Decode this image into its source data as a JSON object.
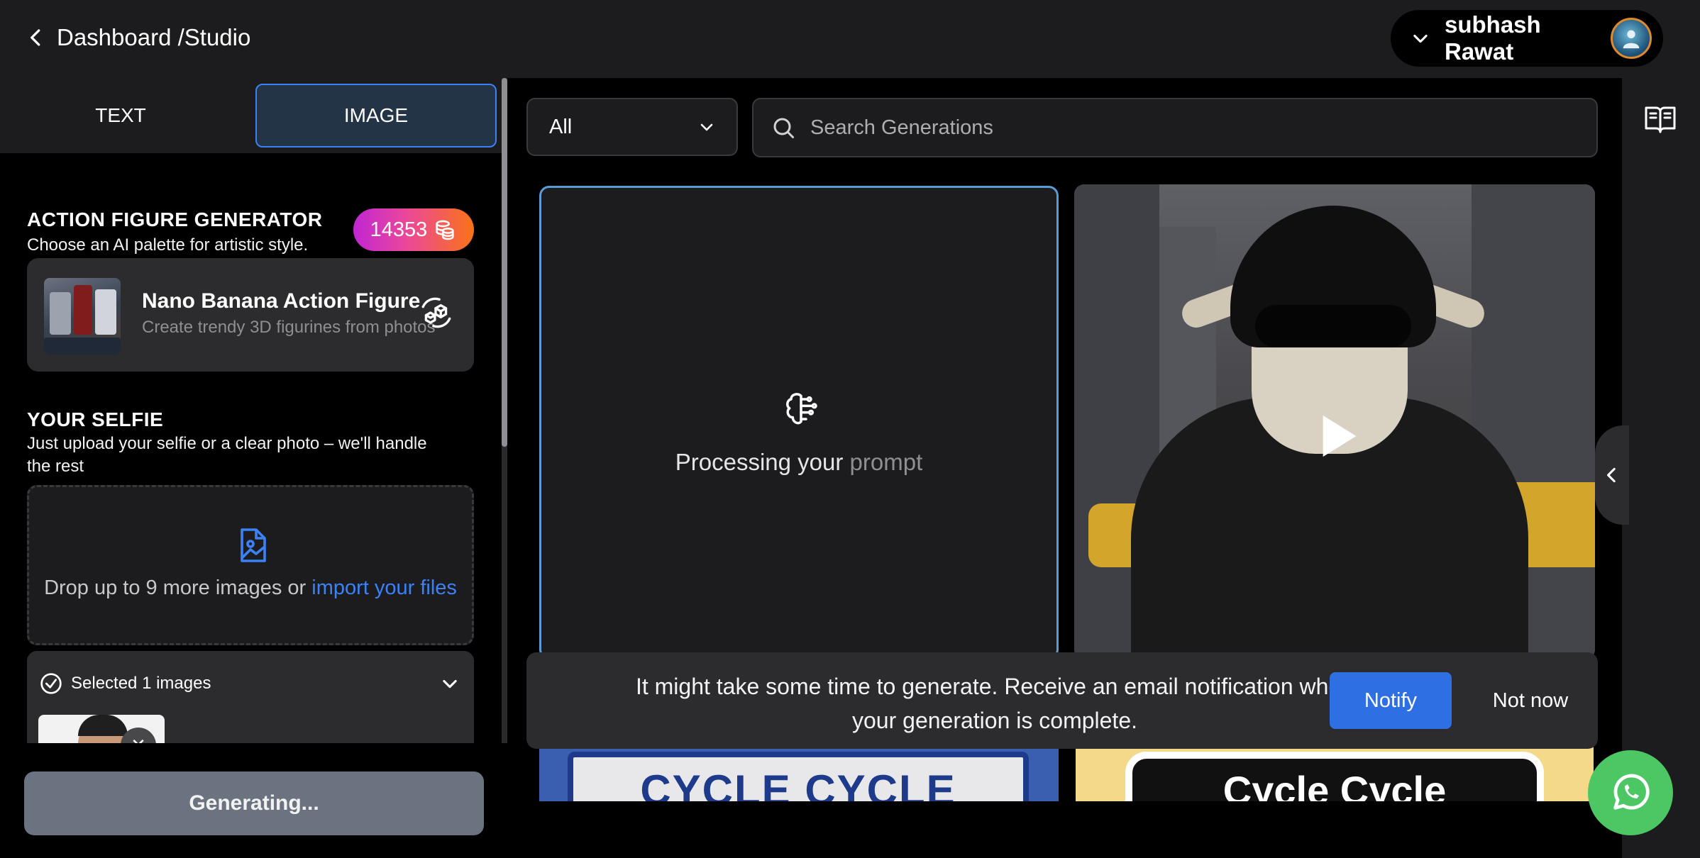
{
  "header": {
    "breadcrumb": "Dashboard /Studio",
    "user_name": "subhash Rawat"
  },
  "tabs": [
    {
      "label": "TEXT",
      "active": false
    },
    {
      "label": "IMAGE",
      "active": true
    }
  ],
  "generator": {
    "title": "ACTION FIGURE GENERATOR",
    "subtitle": "Choose an AI palette for artistic style.",
    "credits": "14353"
  },
  "model": {
    "name": "Nano Banana Action Figure",
    "description": "Create trendy 3D figurines from photos"
  },
  "selfie": {
    "title": "YOUR SELFIE",
    "subtitle_line1": "Just upload your selfie or a clear photo – we'll handle",
    "subtitle_line2": "the rest",
    "drop_text": "Drop up to 9 more images or ",
    "drop_link": "import your files",
    "selected_label": "Selected 1 images",
    "remove_glyph": "✕"
  },
  "generate_button": "Generating...",
  "filter": {
    "selected": "All"
  },
  "search": {
    "placeholder": "Search Generations"
  },
  "processing_card": {
    "text_main": "Processing your ",
    "text_fade": "prompt"
  },
  "thumbnails": {
    "left_text": "CYCLE CYCLE",
    "right_text": "Cycle Cycle"
  },
  "toast": {
    "message_line1": "It might take some time to generate. Receive an email notification when",
    "message_line2": "your generation is complete.",
    "notify_label": "Notify",
    "dismiss_label": "Not now"
  },
  "colors": {
    "accent": "#2f6fe4",
    "tab_active_border": "#3b82f6",
    "whatsapp": "#4cc763",
    "processing_border": "#5b9bd5"
  },
  "icons": [
    "chevron-left-icon",
    "chevron-down-icon",
    "avatar",
    "coins-icon",
    "cube-refresh-icon",
    "image-file-icon",
    "check-circle-icon",
    "close-icon",
    "search-icon",
    "brain-icon",
    "play-icon",
    "book-icon",
    "whatsapp-icon"
  ]
}
